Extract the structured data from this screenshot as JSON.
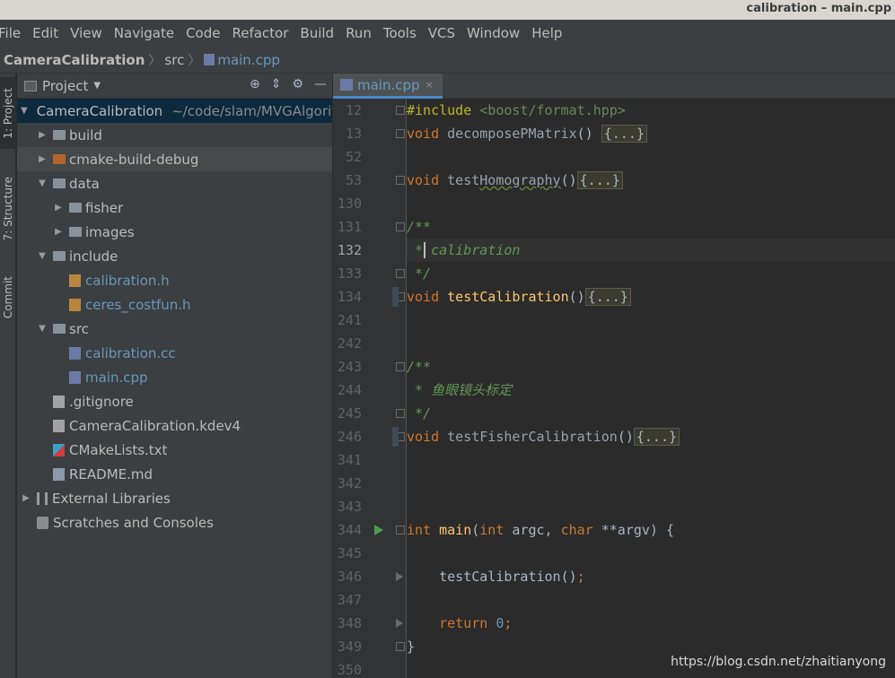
{
  "window": {
    "title": "calibration – main.cpp"
  },
  "menu": [
    "File",
    "Edit",
    "View",
    "Navigate",
    "Code",
    "Refactor",
    "Build",
    "Run",
    "Tools",
    "VCS",
    "Window",
    "Help"
  ],
  "breadcrumb": {
    "project": "CameraCalibration",
    "folder": "src",
    "file": "main.cpp"
  },
  "toolstrip": {
    "project_tab": "1: Project",
    "structure_tab": "7: Structure",
    "commit_tab": "Commit"
  },
  "project_panel": {
    "title": "Project",
    "tree": [
      {
        "label": "CameraCalibration",
        "extra": "~/code/slam/MVGAlgorit",
        "kind": "project",
        "arrow": "▼",
        "level": 0
      },
      {
        "label": "build",
        "kind": "folder",
        "arrow": "▶",
        "level": 1
      },
      {
        "label": "cmake-build-debug",
        "kind": "folder-orange",
        "arrow": "▶",
        "level": 1
      },
      {
        "label": "data",
        "kind": "folder",
        "arrow": "▼",
        "level": 1
      },
      {
        "label": "fisher",
        "kind": "folder",
        "arrow": "▶",
        "level": 2
      },
      {
        "label": "images",
        "kind": "folder",
        "arrow": "▶",
        "level": 2
      },
      {
        "label": "include",
        "kind": "folder",
        "arrow": "▼",
        "level": 1
      },
      {
        "label": "calibration.h",
        "kind": "h",
        "level": 2
      },
      {
        "label": "ceres_costfun.h",
        "kind": "h",
        "level": 2
      },
      {
        "label": "src",
        "kind": "folder",
        "arrow": "▼",
        "level": 1
      },
      {
        "label": "calibration.cc",
        "kind": "cpp",
        "level": 2
      },
      {
        "label": "main.cpp",
        "kind": "cpp",
        "level": 2
      },
      {
        "label": ".gitignore",
        "kind": "text",
        "level": 1
      },
      {
        "label": "CameraCalibration.kdev4",
        "kind": "text",
        "level": 1
      },
      {
        "label": "CMakeLists.txt",
        "kind": "cmake",
        "level": 1
      },
      {
        "label": "README.md",
        "kind": "md",
        "level": 1
      },
      {
        "label": "External Libraries",
        "kind": "lib",
        "arrow": "▶",
        "level": 0
      },
      {
        "label": "Scratches and Consoles",
        "kind": "scratch",
        "level": 0
      }
    ]
  },
  "editor": {
    "tab": {
      "label": "main.cpp",
      "close": "×"
    },
    "lines": [
      {
        "n": "12",
        "t": "#include <boost/format.hpp>"
      },
      {
        "n": "13",
        "t": "void decomposePMatrix() {...}"
      },
      {
        "n": "52",
        "t": ""
      },
      {
        "n": "53",
        "t": "void testHomography(){...}"
      },
      {
        "n": "130",
        "t": ""
      },
      {
        "n": "131",
        "t": "/**"
      },
      {
        "n": "132",
        "t": " * calibration"
      },
      {
        "n": "133",
        "t": " */"
      },
      {
        "n": "134",
        "t": "void testCalibration(){...}"
      },
      {
        "n": "241",
        "t": ""
      },
      {
        "n": "242",
        "t": ""
      },
      {
        "n": "243",
        "t": "/**"
      },
      {
        "n": "244",
        "t": " * 鱼眼镜头标定"
      },
      {
        "n": "245",
        "t": " */"
      },
      {
        "n": "246",
        "t": "void testFisherCalibration(){...}"
      },
      {
        "n": "341",
        "t": ""
      },
      {
        "n": "342",
        "t": ""
      },
      {
        "n": "343",
        "t": ""
      },
      {
        "n": "344",
        "t": "int main(int argc, char **argv) {"
      },
      {
        "n": "345",
        "t": ""
      },
      {
        "n": "346",
        "t": "    testCalibration();"
      },
      {
        "n": "347",
        "t": ""
      },
      {
        "n": "348",
        "t": "    return 0;"
      },
      {
        "n": "349",
        "t": "}"
      },
      {
        "n": "350",
        "t": ""
      }
    ]
  },
  "watermark": "https://blog.csdn.net/zhaitianyong"
}
